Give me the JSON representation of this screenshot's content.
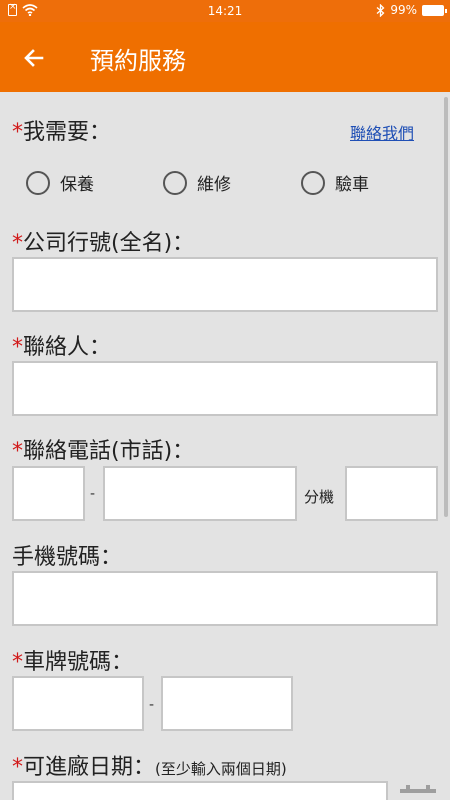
{
  "status_bar": {
    "time": "14:21",
    "battery": "99%"
  },
  "app_bar": {
    "title": "預約服務"
  },
  "form": {
    "need_label": "我需要：",
    "contact_link": "聯絡我們",
    "service_options": [
      "保養",
      "維修",
      "驗車"
    ],
    "company_label": "公司行號(全名)：",
    "contact_person_label": "聯絡人：",
    "phone_label": "聯絡電話(市話)：",
    "phone_dash": "-",
    "extension_label": "分機",
    "mobile_label": "手機號碼：",
    "plate_label": "車牌號碼：",
    "plate_dash": "-",
    "date_label": "可進廠日期：",
    "date_hint": "(至少輸入兩個日期)",
    "required_mark": "*"
  },
  "colors": {
    "accent": "#ef6f00",
    "required": "#d11a1a",
    "link": "#1f4fb5",
    "background": "#e3e3e3"
  }
}
